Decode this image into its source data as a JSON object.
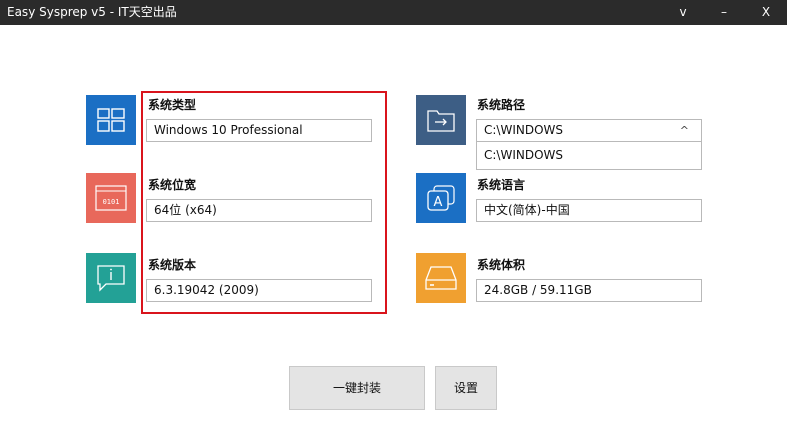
{
  "window": {
    "title": "Easy Sysprep v5 - IT天空出品",
    "controls": {
      "menu": "v",
      "minimize": "–",
      "close": "X"
    }
  },
  "left": {
    "type": {
      "label": "系统类型",
      "value": "Windows 10 Professional",
      "icon": "windows-tiles-icon",
      "color": "#1b6fc4"
    },
    "bitness": {
      "label": "系统位宽",
      "value": "64位 (x64)",
      "icon": "binary-window-icon",
      "color": "#e8685b"
    },
    "version": {
      "label": "系统版本",
      "value": "6.3.19042 (2009)",
      "icon": "info-chat-icon",
      "color": "#23a196"
    }
  },
  "right": {
    "path": {
      "label": "系统路径",
      "value": "C:\\WINDOWS",
      "caret": "^",
      "options": [
        "C:\\WINDOWS"
      ],
      "icon": "folder-arrow-icon",
      "color": "#3d5e85"
    },
    "language": {
      "label": "系统语言",
      "value": "中文(简体)-中国",
      "icon": "language-letter-icon",
      "color": "#1b6fc4"
    },
    "size": {
      "label": "系统体积",
      "value": "24.8GB / 59.11GB",
      "icon": "hard-drive-icon",
      "color": "#f0a030"
    }
  },
  "buttons": {
    "seal": "一键封装",
    "settings": "设置"
  },
  "colors": {
    "highlight": "#d9141c",
    "titlebar": "#2b2b2b"
  }
}
